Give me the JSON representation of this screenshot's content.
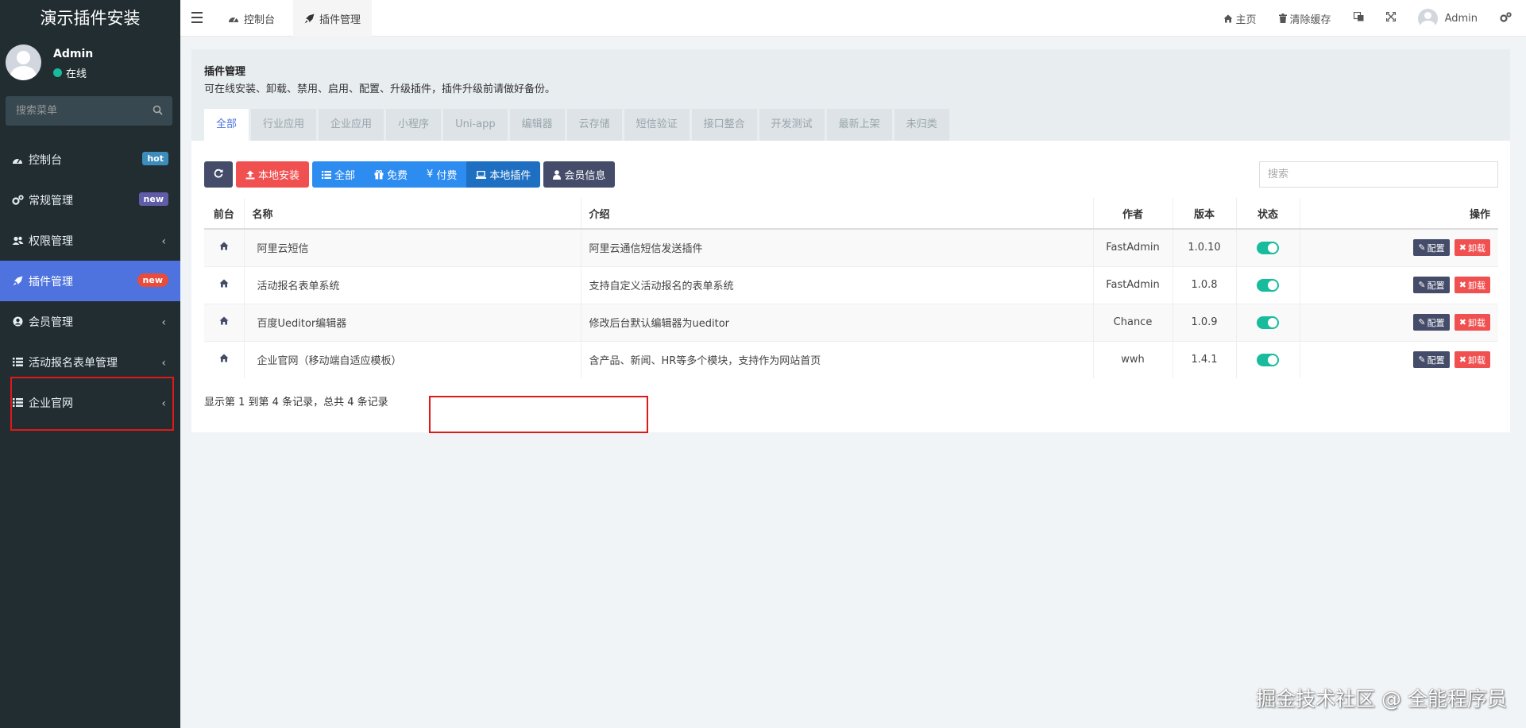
{
  "app": {
    "title": "演示插件安装"
  },
  "user": {
    "name": "Admin",
    "status": "在线"
  },
  "sidebar": {
    "search_placeholder": "搜索菜单",
    "items": [
      {
        "label": "控制台",
        "icon": "dashboard-icon",
        "badge": "hot"
      },
      {
        "label": "常规管理",
        "icon": "cogs-icon",
        "badge": "new"
      },
      {
        "label": "权限管理",
        "icon": "users-icon"
      },
      {
        "label": "插件管理",
        "icon": "rocket-icon",
        "badge": "new",
        "active": true
      },
      {
        "label": "会员管理",
        "icon": "user-circle-icon"
      },
      {
        "label": "活动报名表单管理",
        "icon": "list-icon"
      },
      {
        "label": "企业官网",
        "icon": "list-icon"
      }
    ]
  },
  "topbar": {
    "tabs": [
      {
        "label": "控制台"
      },
      {
        "label": "插件管理",
        "active": true
      }
    ],
    "home_label": "主页",
    "clear_cache_label": "清除缓存",
    "admin_label": "Admin"
  },
  "panel": {
    "title": "插件管理",
    "desc": "可在线安装、卸载、禁用、启用、配置、升级插件，插件升级前请做好备份。",
    "categories": [
      "全部",
      "行业应用",
      "企业应用",
      "小程序",
      "Uni-app",
      "编辑器",
      "云存储",
      "短信验证",
      "接口整合",
      "开发测试",
      "最新上架",
      "未归类"
    ]
  },
  "toolbar": {
    "local_install": "本地安装",
    "filter_all": "全部",
    "filter_free": "免费",
    "filter_paid": "付费",
    "filter_local": "本地插件",
    "member_info": "会员信息",
    "search_placeholder": "搜索"
  },
  "table": {
    "headers": {
      "front": "前台",
      "name": "名称",
      "intro": "介绍",
      "author": "作者",
      "version": "版本",
      "status": "状态",
      "ops": "操作"
    },
    "config_label": "配置",
    "uninstall_label": "卸载",
    "rows": [
      {
        "name": "阿里云短信",
        "intro": "阿里云通信短信发送插件",
        "author": "FastAdmin",
        "version": "1.0.10"
      },
      {
        "name": "活动报名表单系统",
        "intro": "支持自定义活动报名的表单系统",
        "author": "FastAdmin",
        "version": "1.0.8"
      },
      {
        "name": "百度Ueditor编辑器",
        "intro": "修改后台默认编辑器为ueditor",
        "author": "Chance",
        "version": "1.0.9"
      },
      {
        "name": "企业官网（移动端自适应模板）",
        "intro": "含产品、新闻、HR等多个模块，支持作为网站首页",
        "author": "wwh",
        "version": "1.4.1"
      }
    ]
  },
  "pager": {
    "text": "显示第 1 到第 4 条记录，总共 4 条记录"
  },
  "watermark": "掘金技术社区 @ 全能程序员",
  "colors": {
    "accent": "#4e73df",
    "sidebar_bg": "#222d32",
    "success": "#18bc9c",
    "danger": "#f05050",
    "highlight": "#e01818"
  }
}
